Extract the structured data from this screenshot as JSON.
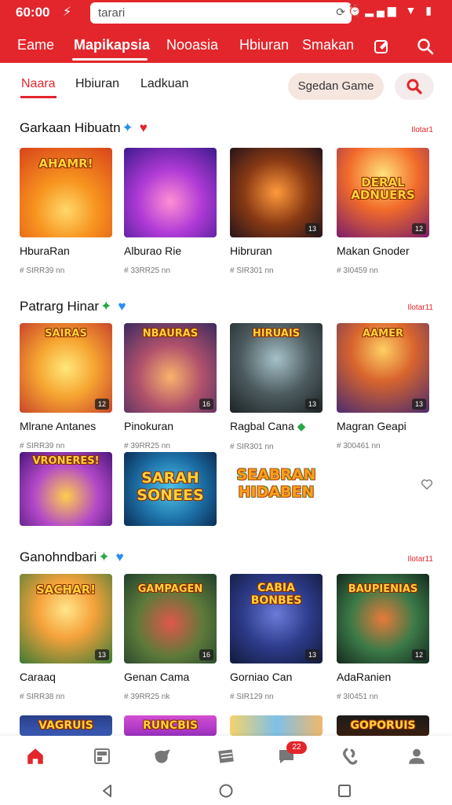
{
  "status_bar": {
    "time": "60:00",
    "bolt_icon": "bolt-icon",
    "url": "tarari",
    "signal_icons": "wifi-signal-battery"
  },
  "nav": {
    "items": [
      "Eame",
      "Mapikapsia",
      "Nooasia",
      "Hbiuran",
      "Smakan"
    ],
    "active_index": 1
  },
  "subtabs": {
    "items": [
      "Naara",
      "Hbiuran",
      "Ladkuan"
    ],
    "active_index": 0,
    "search_label": "Sgedan Game"
  },
  "sections": [
    {
      "title": "Garkaan Hibuatn",
      "emoji1": "✦",
      "emoji2": "♥",
      "more": "Ilotar1",
      "games": [
        {
          "art_text": "AHAMR!",
          "title": "HburaRan",
          "meta": "# SIRR39 nn",
          "badge": ""
        },
        {
          "art_text": "",
          "title": "Alburao Rie",
          "meta": "# 33RR25 nn",
          "badge": ""
        },
        {
          "art_text": "",
          "title": "Hibruran",
          "meta": "# SIR301 nn",
          "badge": "13"
        },
        {
          "art_text": "DERAL ADNUERS",
          "title": "Makan Gnoder",
          "meta": "# 3I0459 nn",
          "badge": "12"
        }
      ]
    },
    {
      "title": "Patrarg Hinar",
      "emoji1": "✦",
      "emoji2": "♥",
      "more": "Ilotar11",
      "games": [
        {
          "art_text": "SAIRAS",
          "title": "Mlrane Antanes",
          "meta": "# SIRR39 nn",
          "badge": "12"
        },
        {
          "art_text": "NBAURAS",
          "title": "Pinokuran",
          "meta": "# 39RR25 nn",
          "badge": "16"
        },
        {
          "art_text": "HIRUAIS",
          "title": "Ragbal Cana",
          "meta": "# SIR301 nn",
          "badge": "13"
        },
        {
          "art_text": "AAMER",
          "title": "Magran Geapi",
          "meta": "# 300461 nn",
          "badge": "13"
        }
      ]
    },
    {
      "title": "",
      "games": [
        {
          "art_text": "VRONERES!",
          "title": "",
          "meta": "",
          "badge": ""
        },
        {
          "art_text": "SARAH SONEES",
          "title": "",
          "meta": "",
          "badge": ""
        },
        {
          "art_text": "SEABRAN HIDABEN",
          "title": "",
          "meta": "",
          "badge": ""
        }
      ]
    },
    {
      "title": "Ganohndbari",
      "emoji1": "✦",
      "emoji2": "♥",
      "more": "Ilotar11",
      "games": [
        {
          "art_text": "SACHAR!",
          "title": "Caraaq",
          "meta": "# SIRR38 nn",
          "badge": "13"
        },
        {
          "art_text": "GAMPAGEN",
          "title": "Genan Cama",
          "meta": "# 39RR25 nk",
          "badge": "16"
        },
        {
          "art_text": "CABIA BONBES",
          "title": "Gorniao Can",
          "meta": "# SIR129 nn",
          "badge": "13"
        },
        {
          "art_text": "BAUPIENIAS",
          "title": "AdaRanien",
          "meta": "# 3I0451 nn",
          "badge": "12"
        }
      ]
    },
    {
      "title": "",
      "games": [
        {
          "art_text": "VAGRUIS",
          "title": "",
          "meta": "",
          "badge": ""
        },
        {
          "art_text": "RUNCBIS",
          "title": "",
          "meta": "",
          "badge": ""
        },
        {
          "art_text": "",
          "title": "",
          "meta": "",
          "badge": ""
        },
        {
          "art_text": "GOPORUIS",
          "title": "",
          "meta": "",
          "badge": ""
        }
      ]
    }
  ],
  "bottom_nav": {
    "icons": [
      "home-icon",
      "library-icon",
      "explore-icon",
      "cards-icon",
      "messages-icon",
      "link-icon",
      "profile-icon"
    ],
    "badge": "22"
  },
  "colors": {
    "brand_red": "#e3262c",
    "accent_green": "#28a745",
    "accent_blue": "#2a8ef0"
  }
}
